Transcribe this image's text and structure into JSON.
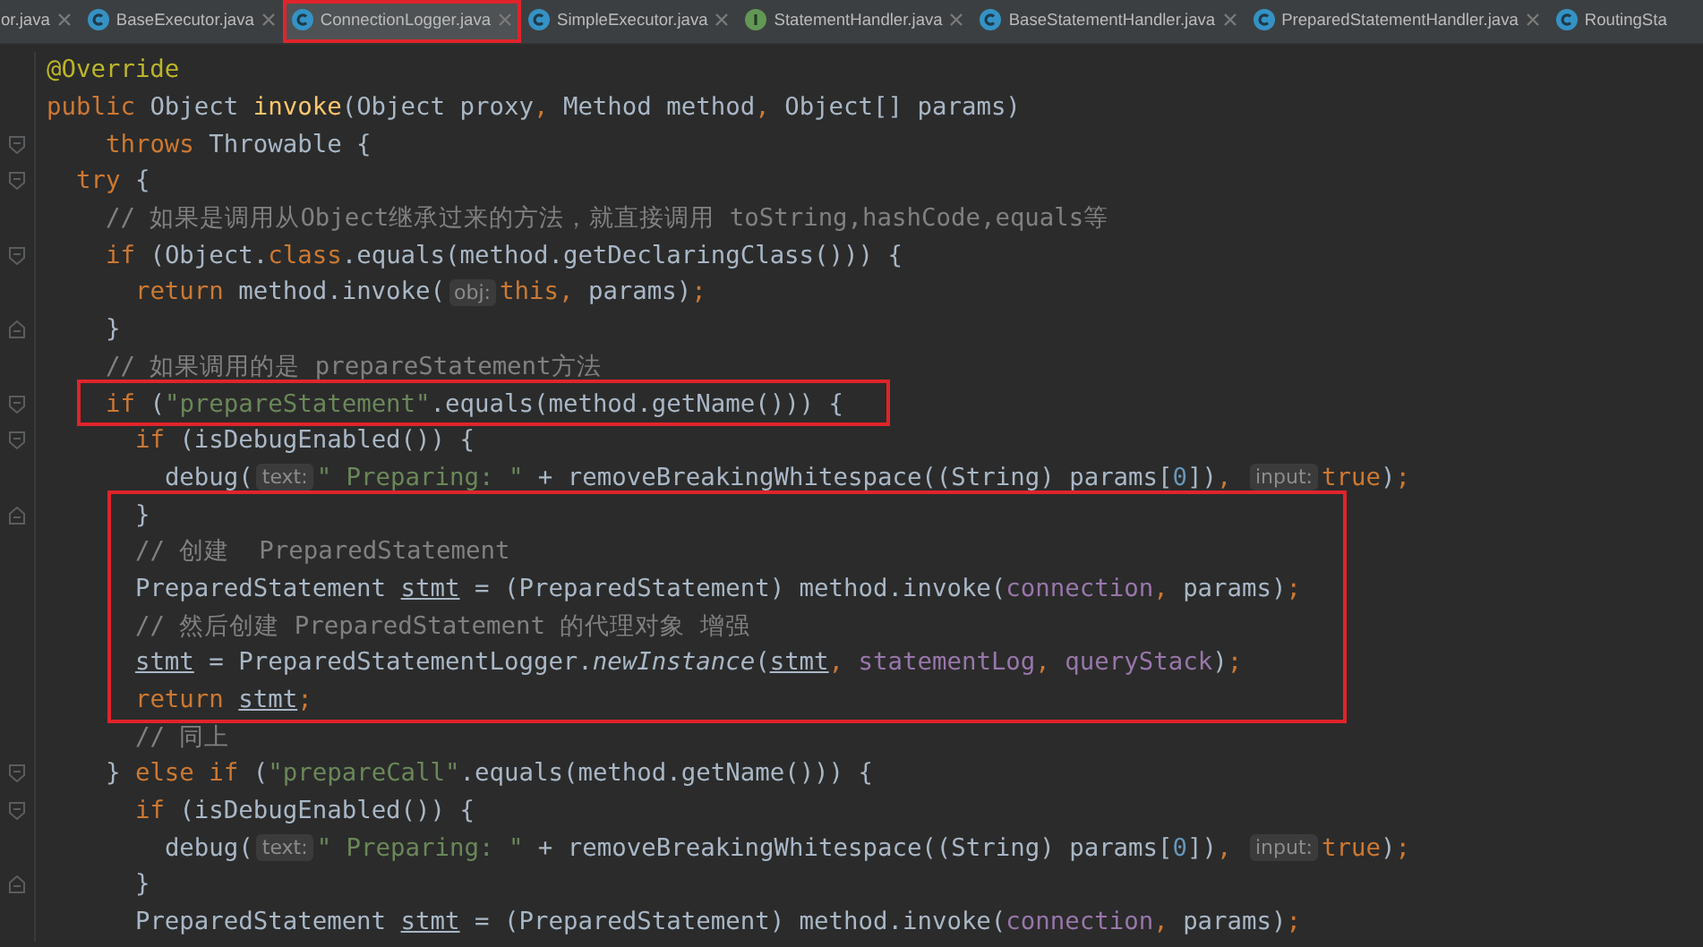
{
  "tabs": [
    {
      "label": "or.java",
      "kind": "plain",
      "selected": false,
      "outlined": false
    },
    {
      "label": "BaseExecutor.java",
      "kind": "class",
      "selected": false,
      "outlined": false
    },
    {
      "label": "ConnectionLogger.java",
      "kind": "class",
      "selected": true,
      "outlined": true
    },
    {
      "label": "SimpleExecutor.java",
      "kind": "class",
      "selected": false,
      "outlined": false
    },
    {
      "label": "StatementHandler.java",
      "kind": "interface",
      "selected": false,
      "outlined": false
    },
    {
      "label": "BaseStatementHandler.java",
      "kind": "class",
      "selected": false,
      "outlined": false
    },
    {
      "label": "PreparedStatementHandler.java",
      "kind": "class",
      "selected": false,
      "outlined": false
    },
    {
      "label": "RoutingSta",
      "kind": "class",
      "selected": false,
      "outlined": false
    }
  ],
  "editor": {
    "lines": [
      {
        "tokens": [
          {
            "kind": "annotation",
            "text": "@Override"
          }
        ]
      },
      {
        "tokens": [
          {
            "kind": "keyword",
            "text": "public "
          },
          {
            "kind": "plain",
            "text": "Object "
          },
          {
            "kind": "method",
            "text": "invoke"
          },
          {
            "kind": "plain",
            "text": "(Object proxy"
          },
          {
            "kind": "keyword",
            "text": ", "
          },
          {
            "kind": "plain",
            "text": "Method method"
          },
          {
            "kind": "keyword",
            "text": ", "
          },
          {
            "kind": "plain",
            "text": "Object[] params)"
          }
        ]
      },
      {
        "kind": "opener",
        "tokens": [
          {
            "kind": "keyword",
            "text": "    throws "
          },
          {
            "kind": "plain",
            "text": "Throwable {"
          }
        ]
      },
      {
        "kind": "opener",
        "tokens": [
          {
            "kind": "keyword",
            "text": "  try "
          },
          {
            "kind": "plain",
            "text": "{"
          }
        ]
      },
      {
        "tokens": [
          {
            "kind": "comment",
            "text": "    // 如果是调用从Object继承过来的方法，就直接调用 toString,hashCode,equals等"
          }
        ]
      },
      {
        "kind": "opener",
        "tokens": [
          {
            "kind": "keyword",
            "text": "    if "
          },
          {
            "kind": "plain",
            "text": "(Object."
          },
          {
            "kind": "keyword",
            "text": "class"
          },
          {
            "kind": "plain",
            "text": ".equals(method.getDeclaringClass())) {"
          }
        ]
      },
      {
        "tokens": [
          {
            "kind": "keyword",
            "text": "      return "
          },
          {
            "kind": "plain",
            "text": "method.invoke("
          },
          {
            "kind": "hint",
            "text": "obj:"
          },
          {
            "kind": "keyword",
            "text": "this, "
          },
          {
            "kind": "plain",
            "text": "params)"
          },
          {
            "kind": "keyword",
            "text": ";"
          }
        ]
      },
      {
        "kind": "closer",
        "tokens": [
          {
            "kind": "plain",
            "text": "    }"
          }
        ]
      },
      {
        "tokens": [
          {
            "kind": "comment",
            "text": "    // 如果调用的是 prepareStatement方法"
          }
        ]
      },
      {
        "kind": "opener",
        "marked": true,
        "tokens": [
          {
            "kind": "keyword",
            "text": "    if "
          },
          {
            "kind": "plain",
            "text": "("
          },
          {
            "kind": "string",
            "text": "\"prepareStatement\""
          },
          {
            "kind": "plain",
            "text": ".equals(method.getName())) {"
          }
        ]
      },
      {
        "kind": "opener",
        "tokens": [
          {
            "kind": "keyword",
            "text": "      if "
          },
          {
            "kind": "plain",
            "text": "(isDebugEnabled()) {"
          }
        ]
      },
      {
        "tokens": [
          {
            "kind": "plain",
            "text": "        debug("
          },
          {
            "kind": "hint",
            "text": "text:"
          },
          {
            "kind": "string",
            "text": "\" Preparing: \""
          },
          {
            "kind": "plain",
            "text": " + removeBreakingWhitespace((String) params["
          },
          {
            "kind": "number",
            "text": "0"
          },
          {
            "kind": "plain",
            "text": "])"
          },
          {
            "kind": "keyword",
            "text": ", "
          },
          {
            "kind": "hint",
            "text": "input:"
          },
          {
            "kind": "keyword",
            "text": "true"
          },
          {
            "kind": "plain",
            "text": ")"
          },
          {
            "kind": "keyword",
            "text": ";"
          }
        ]
      },
      {
        "kind": "closer",
        "marked": true,
        "tokens": [
          {
            "kind": "plain",
            "text": "      }"
          }
        ]
      },
      {
        "marked": true,
        "tokens": [
          {
            "kind": "comment",
            "text": "      // 创建  PreparedStatement"
          }
        ]
      },
      {
        "marked": true,
        "tokens": [
          {
            "kind": "plain",
            "text": "      PreparedStatement "
          },
          {
            "kind": "local",
            "text": "stmt"
          },
          {
            "kind": "plain",
            "text": " = (PreparedStatement) method.invoke("
          },
          {
            "kind": "field",
            "text": "connection"
          },
          {
            "kind": "keyword",
            "text": ", "
          },
          {
            "kind": "plain",
            "text": "params)"
          },
          {
            "kind": "keyword",
            "text": ";"
          }
        ]
      },
      {
        "marked": true,
        "tokens": [
          {
            "kind": "comment",
            "text": "      // 然后创建 PreparedStatement 的代理对象 增强"
          }
        ]
      },
      {
        "marked": true,
        "tokens": [
          {
            "kind": "local",
            "text": "      stmt"
          },
          {
            "kind": "plain",
            "text": " = PreparedStatementLogger."
          },
          {
            "kind": "static",
            "text": "newInstance"
          },
          {
            "kind": "plain",
            "text": "("
          },
          {
            "kind": "local",
            "text": "stmt"
          },
          {
            "kind": "keyword",
            "text": ", "
          },
          {
            "kind": "field",
            "text": "statementLog"
          },
          {
            "kind": "keyword",
            "text": ", "
          },
          {
            "kind": "field",
            "text": "queryStack"
          },
          {
            "kind": "plain",
            "text": ")"
          },
          {
            "kind": "keyword",
            "text": ";"
          }
        ]
      },
      {
        "marked": true,
        "tokens": [
          {
            "kind": "keyword",
            "text": "      return "
          },
          {
            "kind": "local",
            "text": "stmt"
          },
          {
            "kind": "keyword",
            "text": ";"
          }
        ]
      },
      {
        "tokens": [
          {
            "kind": "comment",
            "text": "      // 同上"
          }
        ]
      },
      {
        "kind": "opener",
        "tokens": [
          {
            "kind": "plain",
            "text": "    } "
          },
          {
            "kind": "keyword",
            "text": "else if "
          },
          {
            "kind": "plain",
            "text": "("
          },
          {
            "kind": "string",
            "text": "\"prepareCall\""
          },
          {
            "kind": "plain",
            "text": ".equals(method.getName())) {"
          }
        ]
      },
      {
        "kind": "opener",
        "tokens": [
          {
            "kind": "keyword",
            "text": "      if "
          },
          {
            "kind": "plain",
            "text": "(isDebugEnabled()) {"
          }
        ]
      },
      {
        "tokens": [
          {
            "kind": "plain",
            "text": "        debug("
          },
          {
            "kind": "hint",
            "text": "text:"
          },
          {
            "kind": "string",
            "text": "\" Preparing: \""
          },
          {
            "kind": "plain",
            "text": " + removeBreakingWhitespace((String) params["
          },
          {
            "kind": "number",
            "text": "0"
          },
          {
            "kind": "plain",
            "text": "])"
          },
          {
            "kind": "keyword",
            "text": ", "
          },
          {
            "kind": "hint",
            "text": "input:"
          },
          {
            "kind": "keyword",
            "text": "true"
          },
          {
            "kind": "plain",
            "text": ")"
          },
          {
            "kind": "keyword",
            "text": ";"
          }
        ]
      },
      {
        "kind": "closer",
        "tokens": [
          {
            "kind": "plain",
            "text": "      }"
          }
        ]
      },
      {
        "tokens": [
          {
            "kind": "plain",
            "text": "      PreparedStatement "
          },
          {
            "kind": "local",
            "text": "stmt"
          },
          {
            "kind": "plain",
            "text": " = (PreparedStatement) method.invoke("
          },
          {
            "kind": "field",
            "text": "connection"
          },
          {
            "kind": "keyword",
            "text": ", "
          },
          {
            "kind": "plain",
            "text": "params)"
          },
          {
            "kind": "keyword",
            "text": ";"
          }
        ]
      }
    ]
  }
}
